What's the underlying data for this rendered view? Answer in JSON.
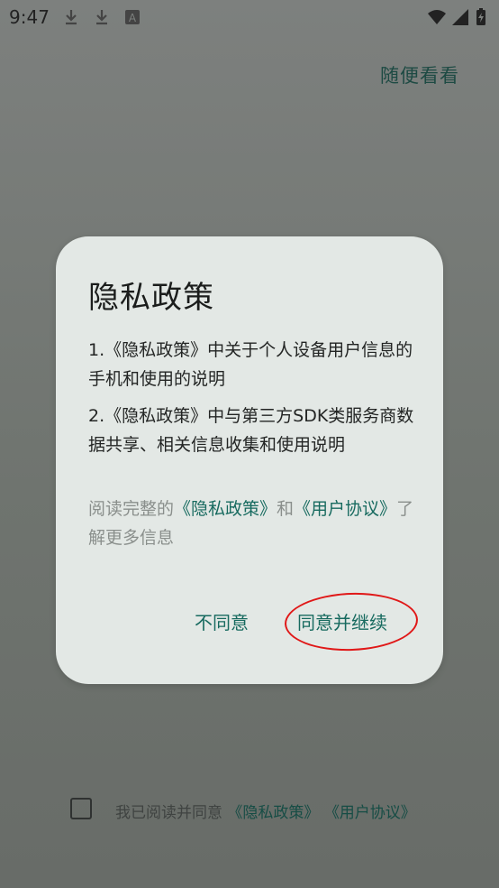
{
  "status_bar": {
    "time": "9:47",
    "icons": [
      "download-icon",
      "download-icon",
      "a-badge-icon",
      "wifi-icon",
      "signal-icon",
      "battery-charging-icon"
    ]
  },
  "top_link": "随便看看",
  "dialog": {
    "title": "隐私政策",
    "item1": "1.《隐私政策》中关于个人设备用户信息的手机和使用的说明",
    "item2": "2.《隐私政策》中与第三方SDK类服务商数据共享、相关信息收集和使用说明",
    "read_prefix": "阅读完整的",
    "privacy_link": "《隐私政策》",
    "and": "和",
    "user_link": "《用户协议》",
    "read_suffix": "了解更多信息",
    "disagree": "不同意",
    "agree": "同意并继续"
  },
  "consent": {
    "checked": false,
    "text": "我已阅读并同意",
    "privacy_link": "《隐私政策》",
    "user_link": "《用户协议》"
  },
  "colors": {
    "accent": "#176a5f",
    "dialog_bg": "#e3e8e5",
    "annotation": "#e01818"
  }
}
